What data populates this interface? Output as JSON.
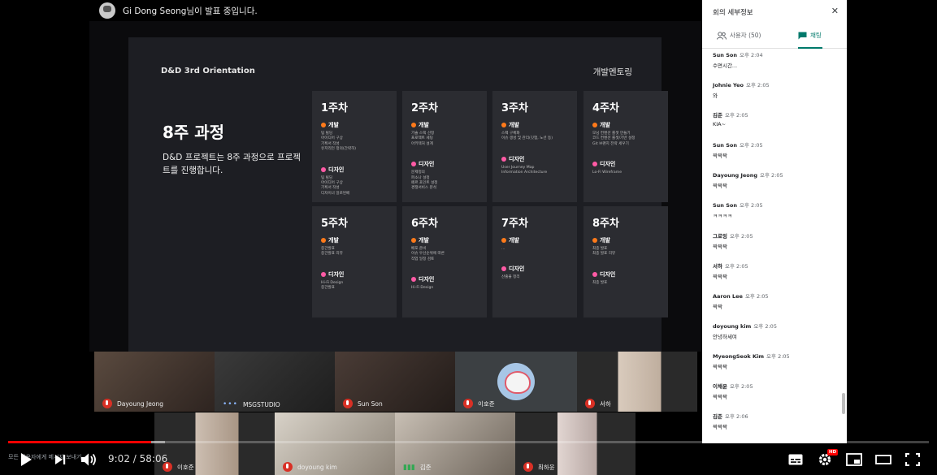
{
  "presenter": {
    "text": "Gi Dong Seong님이 발표 중입니다."
  },
  "slide": {
    "header_left": "D&D 3rd Orientation",
    "header_right": "개발멘토링",
    "title": "8주 과정",
    "subtitle": "D&D 프로젝트는 8주 과정으로 프로젝트를 진행합니다.",
    "weeks": [
      {
        "title": "1주차",
        "dev_label": "개발",
        "dev_items": [
          "팀 빌딩",
          "아이디어 구상",
          "기획서 작성",
          "유저리턴 정의(간략히)"
        ],
        "design_label": "디자인",
        "design_items": [
          "팀 빌딩",
          "아이디어 구상",
          "기획서 작성",
          "디자이너 일로된베"
        ]
      },
      {
        "title": "2주차",
        "dev_label": "개발",
        "dev_items": [
          "기술 스택 선정",
          "프로젝트 세팅",
          "아키텍처 설계"
        ],
        "design_label": "디자인",
        "design_items": [
          "문제정의",
          "퍼소나 설정",
          "페르 포인트 설정",
          "경쟁서비스 분석"
        ]
      },
      {
        "title": "3주차",
        "dev_label": "개발",
        "dev_items": [
          "스펙 구체화",
          "이슈 생성 및 관리(깃헙, 노션 등)"
        ],
        "design_label": "디자인",
        "design_items": [
          "User Journey Map",
          "Information Architecture"
        ]
      },
      {
        "title": "4주차",
        "dev_label": "개발",
        "dev_items": [
          "모닝 컨벤션 룰셋 만들기",
          "코드 컨벤션 룰셋/기반 설정",
          "Git 브랜치 전략 세우기"
        ],
        "design_label": "디자인",
        "design_items": [
          "Lo-Fi Wireframe"
        ]
      },
      {
        "title": "5주차",
        "dev_label": "개발",
        "dev_items": [
          "중간발표",
          "중간발표 리뷰"
        ],
        "design_label": "디자인",
        "design_items": [
          "Hi-Fi Design",
          "중간발표"
        ]
      },
      {
        "title": "6주차",
        "dev_label": "개발",
        "dev_items": [
          "배포 준비",
          "이슈 우선순위에 따른",
          "작업 일정 검토"
        ],
        "design_label": "디자인",
        "design_items": [
          "Hi-Fi Design"
        ]
      },
      {
        "title": "7주차",
        "dev_label": "개발",
        "dev_items": [
          "..."
        ],
        "design_label": "디자인",
        "design_items": [
          "산출물 정리"
        ]
      },
      {
        "title": "8주차",
        "dev_label": "개발",
        "dev_items": [
          "최종 발표",
          "최종 발표 리뷰"
        ],
        "design_label": "디자인",
        "design_items": [
          "최종 발표"
        ]
      }
    ]
  },
  "participants": {
    "row1": [
      {
        "name": "Dayoung Jeong",
        "status": "mic-off"
      },
      {
        "name": "MSGSTUDIO",
        "status": "speaking-dots"
      },
      {
        "name": "Sun Son",
        "status": "mic-off"
      },
      {
        "name": "이호준",
        "status": "mic-off"
      },
      {
        "name": "서하",
        "status": "mic-off"
      }
    ],
    "row2": [
      {
        "name": "이호준",
        "status": "mic-off"
      },
      {
        "name": "doyoung kim",
        "status": "mic-off"
      },
      {
        "name": "김준",
        "status": "speaking"
      },
      {
        "name": "최하윤",
        "status": "mic-off"
      }
    ]
  },
  "chat": {
    "panel_title": "회의 세부정보",
    "tab_people": "사용자 (50)",
    "tab_chat": "채팅",
    "input_placeholder": "모든 사용자에게 메시지 보내기",
    "messages": [
      {
        "sender": "Sun Son",
        "time": "오후 2:04",
        "text": "수면시간..."
      },
      {
        "sender": "Johnie Yeo",
        "time": "오후 2:05",
        "text": "와"
      },
      {
        "sender": "김준",
        "time": "오후 2:05",
        "text": "KIA~"
      },
      {
        "sender": "Sun Son",
        "time": "오후 2:05",
        "text": "짝짝짝"
      },
      {
        "sender": "Dayoung Jeong",
        "time": "오후 2:05",
        "text": "짝짝짝"
      },
      {
        "sender": "Sun Son",
        "time": "오후 2:05",
        "text": "ㅋㅋㅋㅋ"
      },
      {
        "sender": "그로잉",
        "time": "오후 2:05",
        "text": "짝짝짝"
      },
      {
        "sender": "서하",
        "time": "오후 2:05",
        "text": "짝짝짝"
      },
      {
        "sender": "Aaron Lee",
        "time": "오후 2:05",
        "text": "짝짝"
      },
      {
        "sender": "doyoung kim",
        "time": "오후 2:05",
        "text": "안녕하세여"
      },
      {
        "sender": "MyeongSeok Kim",
        "time": "오후 2:05",
        "text": "짝짝짝"
      },
      {
        "sender": "이채윤",
        "time": "오후 2:05",
        "text": "짝짝짝"
      },
      {
        "sender": "김준",
        "time": "오후 2:06",
        "text": "짝짝짝"
      }
    ]
  },
  "player": {
    "current_time": "9:02",
    "separator": " / ",
    "duration": "58:06",
    "played_fraction": 0.155,
    "buffered_fraction": 0.17,
    "hd_badge": "HD",
    "icons": [
      "play-icon",
      "next-icon",
      "volume-icon",
      "subtitles-icon",
      "settings-icon",
      "miniplayer-icon",
      "theater-icon",
      "fullscreen-icon"
    ],
    "accent_color": "#ff0000"
  }
}
